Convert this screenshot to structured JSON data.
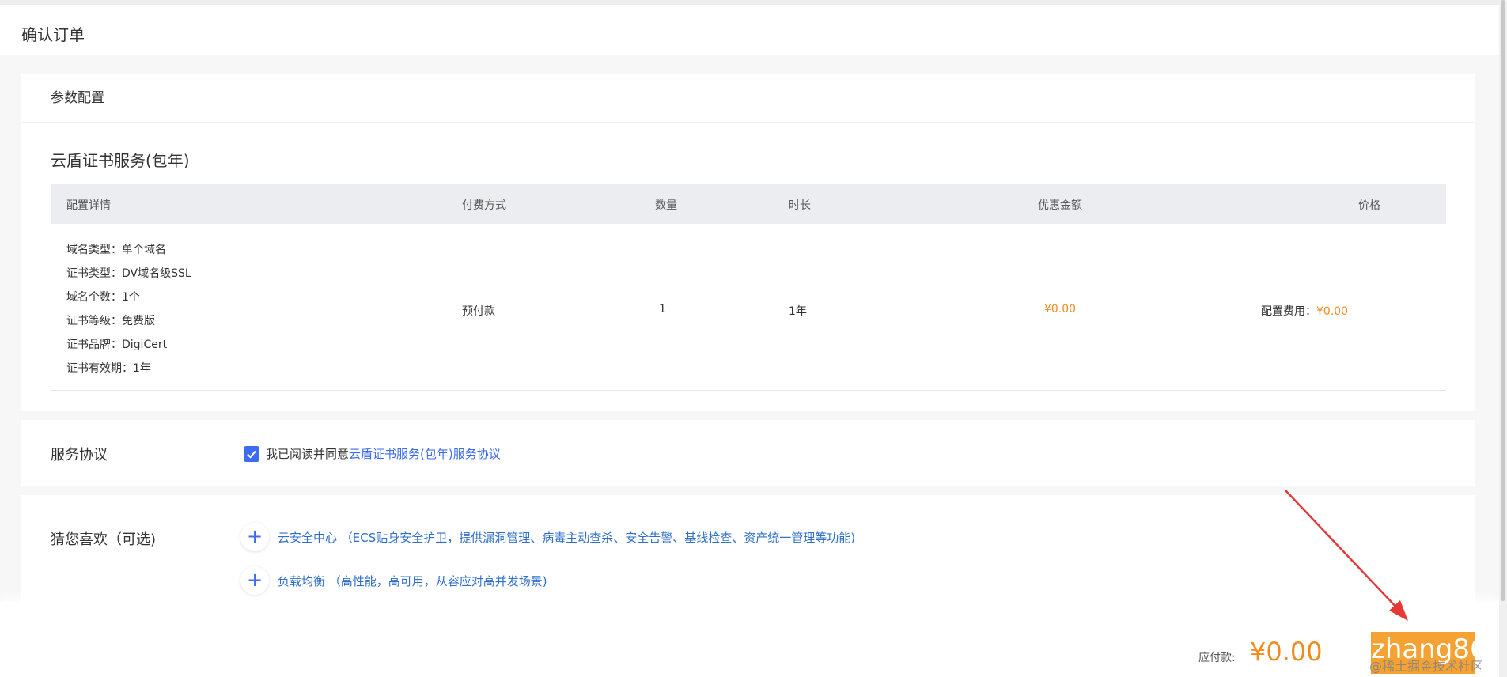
{
  "page": {
    "title": "确认订单"
  },
  "config": {
    "heading": "参数配置",
    "product": "云盾证书服务(包年)",
    "headers": {
      "details": "配置详情",
      "payment": "付费方式",
      "quantity": "数量",
      "duration": "时长",
      "discount": "优惠金额",
      "price": "价格"
    },
    "details": [
      "域名类型：单个域名",
      "证书类型：DV域名级SSL",
      "域名个数：1个",
      "证书等级：免费版",
      "证书品牌：DigiCert",
      "证书有效期：1年"
    ],
    "row": {
      "payment": "预付款",
      "quantity": "1",
      "duration": "1年",
      "discount": "¥0.00",
      "price_label": "配置费用：",
      "price_value": "¥0.00"
    }
  },
  "agreement": {
    "label": "服务协议",
    "checked": true,
    "text": "我已阅读并同意",
    "link": "云盾证书服务(包年)服务协议"
  },
  "recommend": {
    "label": "猜您喜欢（可选)",
    "items": [
      "云安全中心 （ECS贴身安全护卫，提供漏洞管理、病毒主动查杀、安全告警、基线检查、资产统一管理等功能)",
      "负载均衡 （高性能，高可用，从容应对高并发场景)"
    ]
  },
  "footer": {
    "pay_label": "应付款:",
    "pay_amount": "¥0.00",
    "watermark_big": "zhang86",
    "watermark_small": "@稀土掘金技术社区"
  },
  "colors": {
    "accent_blue": "#3d6cf0",
    "price_orange": "#f08c1e",
    "button_orange": "#f5a232",
    "arrow_red": "#e53935"
  },
  "icons": [
    "check-icon",
    "plus-icon",
    "arrow-annotation"
  ]
}
